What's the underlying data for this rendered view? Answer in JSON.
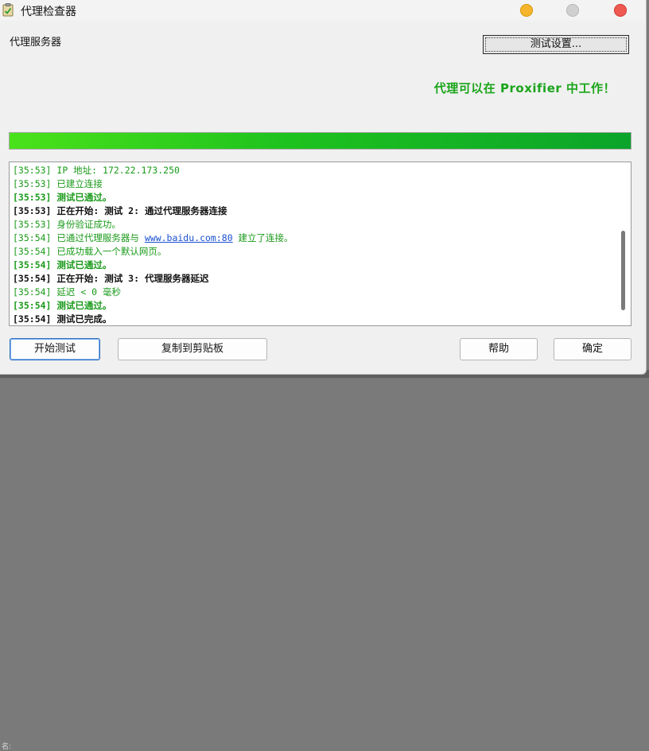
{
  "window": {
    "title": "代理检查器"
  },
  "proxy_section_label": "代理服务器",
  "settings_button_label": "测试设置...",
  "status_message": "代理可以在 Proxifier 中工作！",
  "progress": {
    "value": 1.0
  },
  "log": {
    "lines": [
      {
        "time": "[35:53]",
        "text": "IP 地址: 172.22.173.250",
        "style": "normal"
      },
      {
        "time": "[35:53]",
        "text": "已建立连接",
        "style": "normal"
      },
      {
        "time": "[35:53]",
        "text": "测试已通过。",
        "style": "bold-green"
      },
      {
        "time": "[35:53]",
        "text": "正在开始: 测试 2: 通过代理服务器连接",
        "style": "bold-black"
      },
      {
        "time": "[35:53]",
        "text": "身份验证成功。",
        "style": "normal"
      },
      {
        "time": "[35:54]",
        "text_before": "已通过代理服务器与 ",
        "link": "www.baidu.com:80",
        "text_after": " 建立了连接。",
        "style": "normal-link"
      },
      {
        "time": "[35:54]",
        "text": "已成功载入一个默认网页。",
        "style": "normal"
      },
      {
        "time": "[35:54]",
        "text": "测试已通过。",
        "style": "bold-green"
      },
      {
        "time": "[35:54]",
        "text": "正在开始: 测试 3: 代理服务器延迟",
        "style": "bold-black"
      },
      {
        "time": "[35:54]",
        "text": "延迟 < 0 毫秒",
        "style": "normal"
      },
      {
        "time": "[35:54]",
        "text": "测试已通过。",
        "style": "bold-green"
      },
      {
        "time": "[35:54]",
        "text": "测试已完成。",
        "style": "bold-black"
      }
    ]
  },
  "buttons": {
    "start_test": "开始测试",
    "copy_clipboard": "复制到剪贴板",
    "help": "帮助",
    "ok": "确定"
  },
  "background_fragment": "名:",
  "colors": {
    "success_green": "#1aa51a",
    "log_green": "#1a9a1a",
    "link_blue": "#1a4fd1",
    "progress_start": "#4ae21a",
    "progress_end": "#0aa42a",
    "close_red": "#ee5a52",
    "minimize_yellow": "#f5b52c"
  },
  "icons": {
    "app": "clipboard-check-icon",
    "minimize": "minimize-circle-icon",
    "maximize": "maximize-circle-icon",
    "close": "close-circle-icon"
  }
}
